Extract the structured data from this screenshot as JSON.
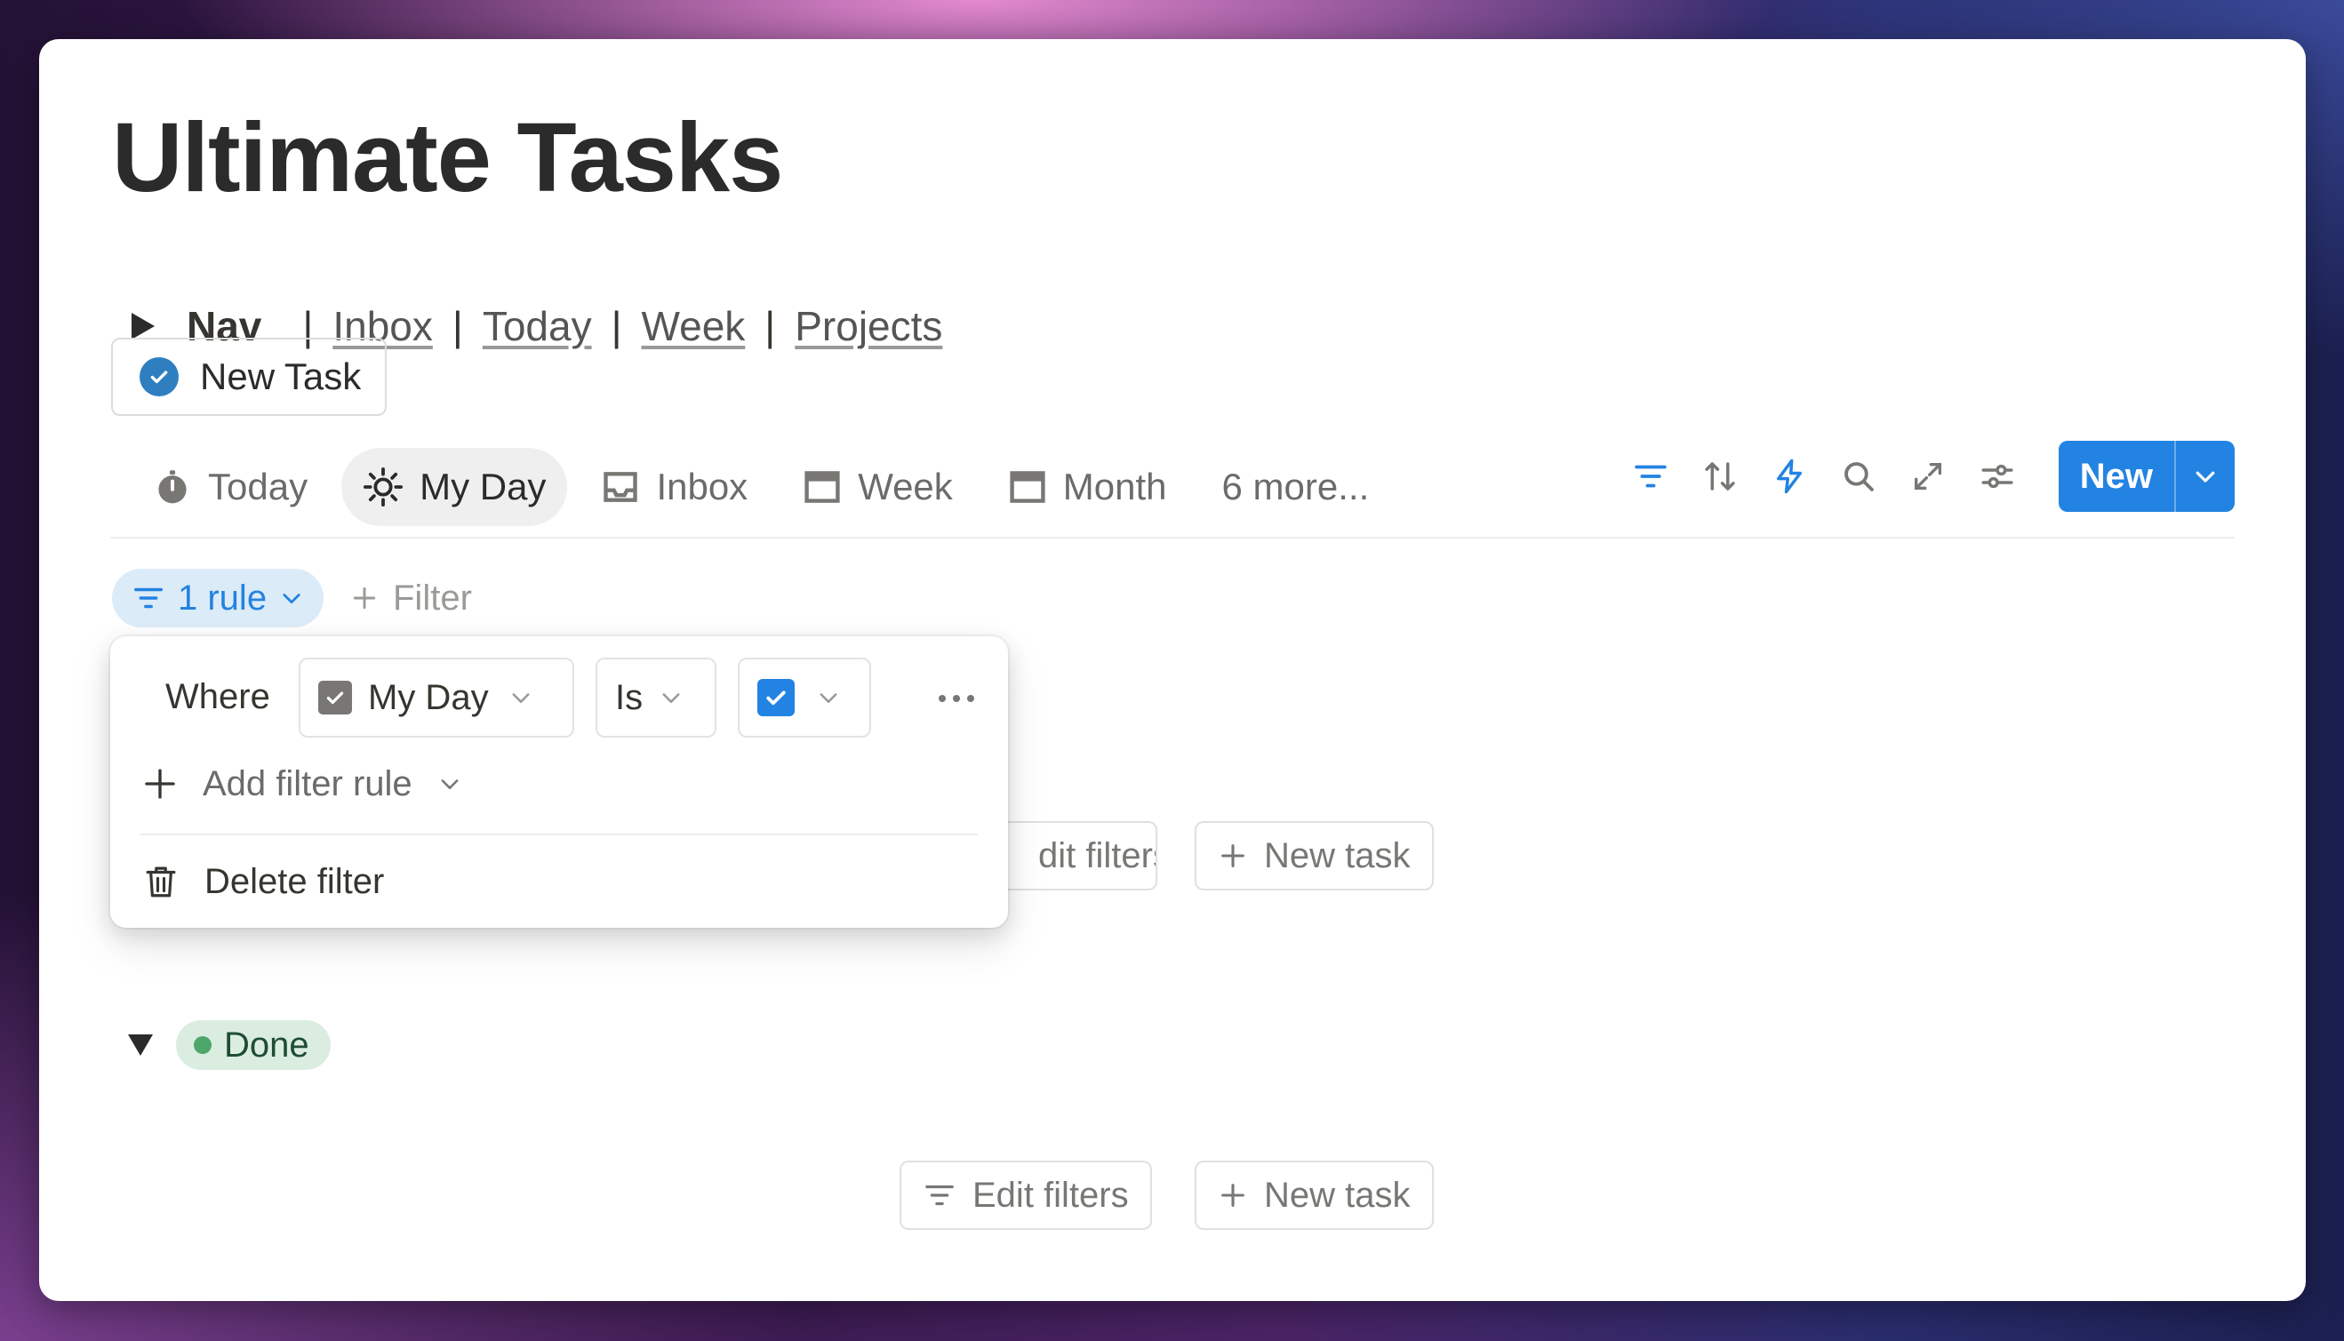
{
  "page": {
    "title": "Ultimate Tasks"
  },
  "nav": {
    "label": "Nav",
    "links": [
      "Inbox",
      "Today",
      "Week",
      "Projects"
    ]
  },
  "new_task_button": {
    "label": "New Task"
  },
  "views": {
    "tabs": [
      {
        "label": "Today",
        "icon": "stopwatch-icon"
      },
      {
        "label": "My Day",
        "icon": "sun-icon",
        "active": true
      },
      {
        "label": "Inbox",
        "icon": "inbox-icon"
      },
      {
        "label": "Week",
        "icon": "calendar-icon"
      },
      {
        "label": "Month",
        "icon": "calendar-icon"
      }
    ],
    "more_label": "6 more..."
  },
  "toolbar": {
    "icons": [
      "filter-icon",
      "sort-icon",
      "lightning-icon",
      "search-icon",
      "expand-icon",
      "settings-sliders-icon"
    ],
    "new_label": "New"
  },
  "filter_bar": {
    "rule_chip_label": "1 rule",
    "add_filter_label": "Filter"
  },
  "filter_popup": {
    "where_label": "Where",
    "property_label": "My Day",
    "operator_label": "Is",
    "value_checked": true,
    "add_rule_label": "Add filter rule",
    "delete_label": "Delete filter"
  },
  "group_actions": {
    "edit_filters_label": "Edit filters",
    "edit_filters_partial": "dit filters",
    "new_task_label": "New task"
  },
  "done_group": {
    "label": "Done"
  },
  "colors": {
    "accent": "#2383e2",
    "done_chip_bg": "#dbede1",
    "done_dot": "#4da66a",
    "rule_chip_bg": "#dcebf8"
  }
}
